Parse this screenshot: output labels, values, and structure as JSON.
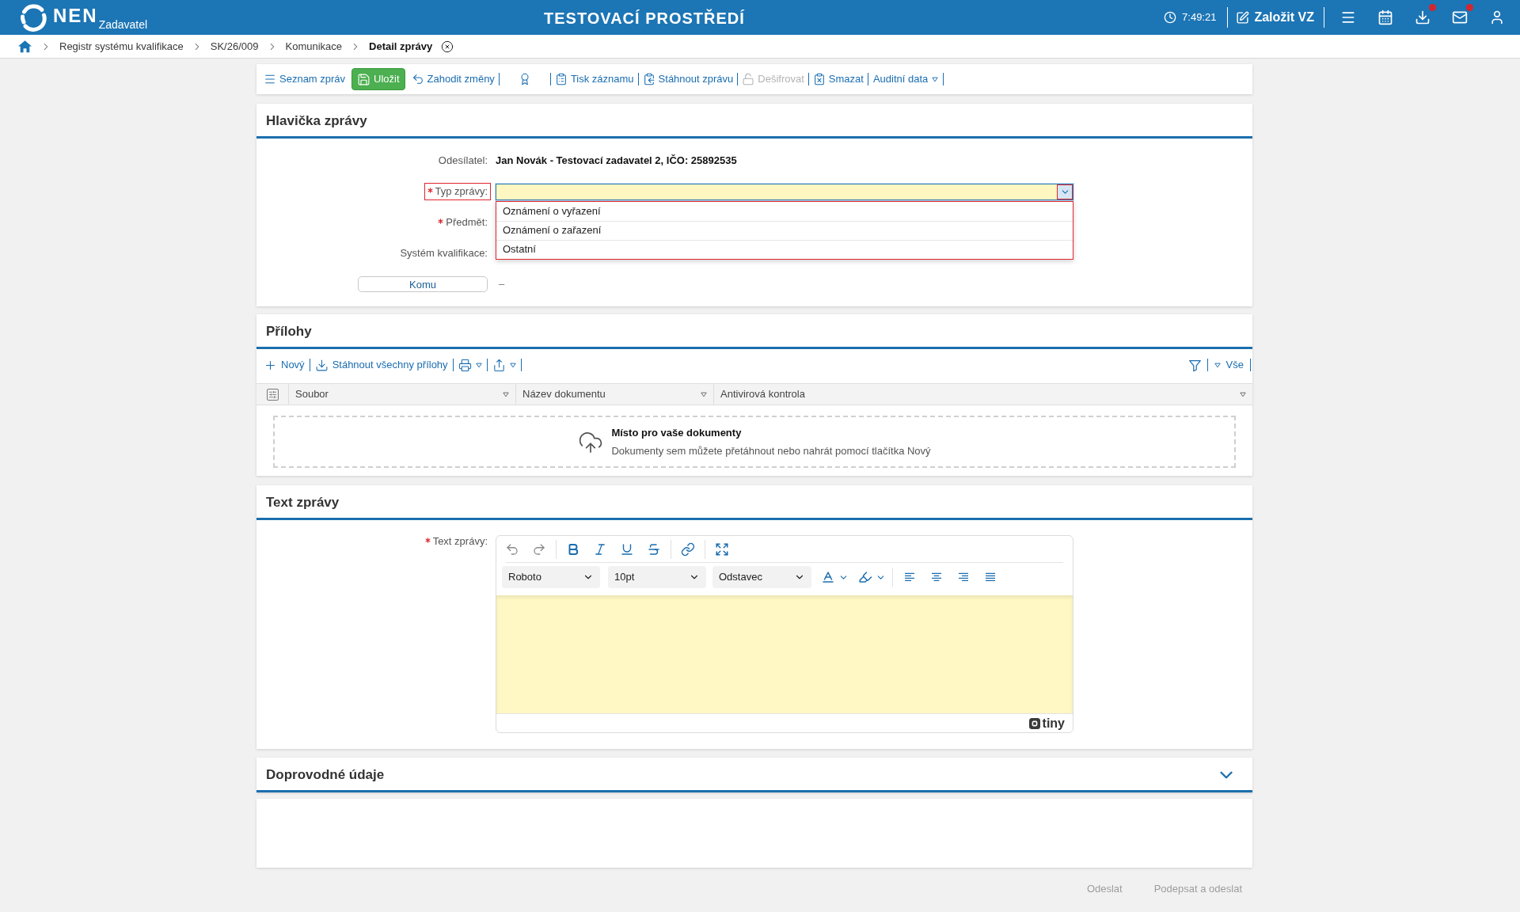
{
  "top_bar": {
    "logo": {
      "name": "NEN",
      "subtitle": "Zadavatel"
    },
    "environment": "TESTOVACÍ PROSTŘEDÍ",
    "clock": "7:49:21",
    "create_button": "Založit VZ",
    "icon_buttons": [
      {
        "kind": "menu",
        "notification": false
      },
      {
        "kind": "calendar",
        "notification": false
      },
      {
        "kind": "download",
        "notification": true
      },
      {
        "kind": "mail",
        "notification": true
      },
      {
        "kind": "user",
        "notification": false
      }
    ]
  },
  "breadcrumb": [
    {
      "label": "Registr systému kvalifikace",
      "current": false
    },
    {
      "label": "SK/26/009",
      "current": false
    },
    {
      "label": "Komunikace",
      "current": false
    },
    {
      "label": "Detail zprávy",
      "current": true
    }
  ],
  "toolbar": [
    {
      "kind": "list",
      "label": "Seznam zpráv",
      "disabled": false
    },
    {
      "kind": "save",
      "label": "Uložit",
      "disabled": false
    },
    {
      "kind": "discard",
      "label": "Zahodit změny",
      "disabled": false
    },
    {
      "kind": "award",
      "disabled": false
    },
    {
      "kind": "print",
      "label": "Tisk záznamu",
      "disabled": false
    },
    {
      "kind": "download",
      "label": "Stáhnout zprávu",
      "disabled": false
    },
    {
      "kind": "decrypt",
      "label": "Dešifrovat",
      "disabled": true
    },
    {
      "kind": "delete",
      "label": "Smazat",
      "disabled": false
    },
    {
      "kind": "menu",
      "label": "Auditní data",
      "disabled": false
    }
  ],
  "message_header": {
    "title": "Hlavička zprávy",
    "fields": [
      {
        "kind": "text",
        "label": "Odesílatel:",
        "required": false,
        "value": "Jan Novák - Testovací zadavatel 2, IČO: 25892535"
      },
      {
        "kind": "select",
        "label": "Typ zprávy:",
        "required": true,
        "invalid": true,
        "expanded": true,
        "options": [
          {
            "label": "Oznámení o vyřazení",
            "selected": false
          },
          {
            "label": "Oznámení o zařazení",
            "selected": false
          },
          {
            "label": "Ostatní",
            "selected": false
          }
        ]
      },
      {
        "kind": "covered",
        "label": "Předmět:",
        "required": true
      },
      {
        "kind": "covered",
        "label": "Systém kvalifikace:",
        "required": false
      },
      {
        "kind": "button",
        "label": "Komu",
        "value": "–"
      }
    ]
  },
  "attachments": {
    "title": "Přílohy",
    "toolbar": [
      {
        "kind": "add",
        "label": "Nový"
      },
      {
        "kind": "download",
        "label": "Stáhnout všechny přílohy"
      },
      {
        "kind": "print"
      },
      {
        "kind": "export"
      }
    ],
    "filter": {
      "label": "Vše"
    },
    "columns": [
      "Soubor",
      "Název dokumentu",
      "Antivirová kontrola"
    ],
    "dropzone": {
      "title": "Místo pro vaše dokumenty",
      "hint": "Dokumenty sem můžete přetáhnout nebo nahrát pomocí tlačítka Nový"
    }
  },
  "message_text": {
    "title": "Text zprávy",
    "label": "Text zprávy:",
    "required": true,
    "editor": {
      "font_family": "Roboto",
      "font_size": "10pt",
      "block_format": "Odstavec",
      "branding": "tiny"
    }
  },
  "supplementary": {
    "title": "Doprovodné údaje"
  },
  "actions": [
    {
      "label": "Odeslat",
      "disabled": true
    },
    {
      "label": "Podepsat a odeslat",
      "disabled": true
    }
  ]
}
